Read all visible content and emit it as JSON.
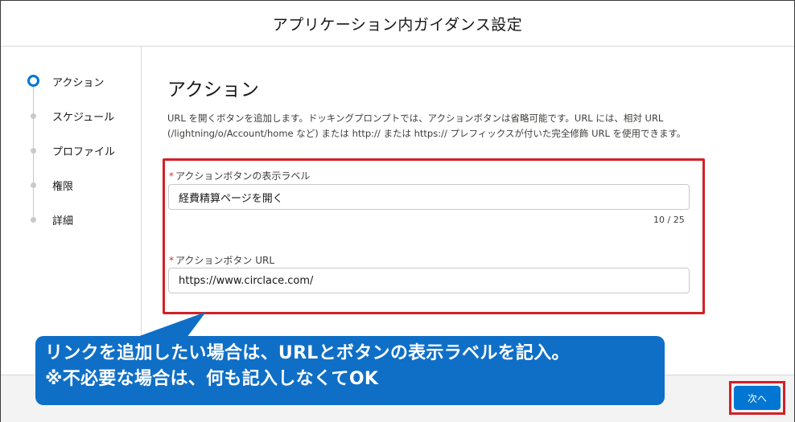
{
  "header": {
    "title": "アプリケーション内ガイダンス設定"
  },
  "sidebar": {
    "steps": [
      {
        "label": "アクション",
        "active": true
      },
      {
        "label": "スケジュール",
        "active": false
      },
      {
        "label": "プロファイル",
        "active": false
      },
      {
        "label": "権限",
        "active": false
      },
      {
        "label": "詳細",
        "active": false
      }
    ]
  },
  "main": {
    "title": "アクション",
    "description_line1": "URL を開くボタンを追加します。ドッキングプロンプトでは、アクションボタンは省略可能です。URL には、相対 URL",
    "description_line2": "(/lightning/o/Account/home など) または http:// または https:// プレフィックスが付いた完全修飾 URL を使用できます。",
    "fields": {
      "button_label": {
        "required_mark": "*",
        "label": "アクションボタンの表示ラベル",
        "value": "経費精算ページを開く",
        "counter": "10 / 25"
      },
      "button_url": {
        "required_mark": "*",
        "label": "アクションボタン URL",
        "value": "https://www.circlace.com/"
      }
    }
  },
  "footer": {
    "next_label": "次へ"
  },
  "callout": {
    "line1": "リンクを追加したい場合は、URLとボタンの表示ラベルを記入。",
    "line2": "※不必要な場合は、何も記入しなくてOK"
  },
  "colors": {
    "accent": "#0176d3",
    "callout": "#0f6fc6",
    "highlight_border": "#d51f26",
    "required": "#c23934"
  }
}
